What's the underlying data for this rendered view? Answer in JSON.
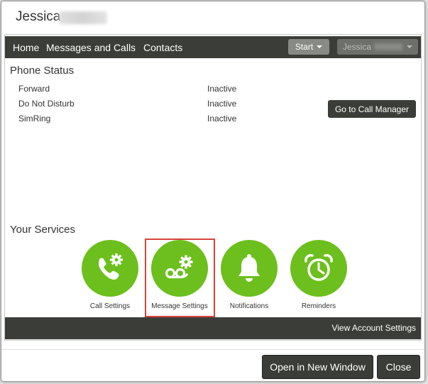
{
  "dialog": {
    "title": "Jessica"
  },
  "nav": {
    "links": [
      "Home",
      "Messages and Calls",
      "Contacts"
    ],
    "start_label": "Start",
    "user_label": "Jessica"
  },
  "phone_status": {
    "title": "Phone Status",
    "rows": [
      {
        "label": "Forward",
        "value": "Inactive"
      },
      {
        "label": "Do Not Disturb",
        "value": "Inactive"
      },
      {
        "label": "SimRing",
        "value": "Inactive"
      }
    ],
    "call_manager_label": "Go to Call Manager"
  },
  "services": {
    "title": "Your Services",
    "items": [
      {
        "label": "Call Settings",
        "icon": "phone-gear-icon"
      },
      {
        "label": "Message Settings",
        "icon": "voicemail-gear-icon"
      },
      {
        "label": "Notifications",
        "icon": "bell-icon"
      },
      {
        "label": "Reminders",
        "icon": "alarm-clock-icon"
      }
    ],
    "service_color": "#6cbf1d",
    "highlight_color": "#d9443a"
  },
  "footer": {
    "account_link": "View Account Settings"
  },
  "buttons": {
    "open_new_window": "Open in New Window",
    "close": "Close"
  },
  "theme": {
    "dark_bar": "#3b3e38"
  }
}
